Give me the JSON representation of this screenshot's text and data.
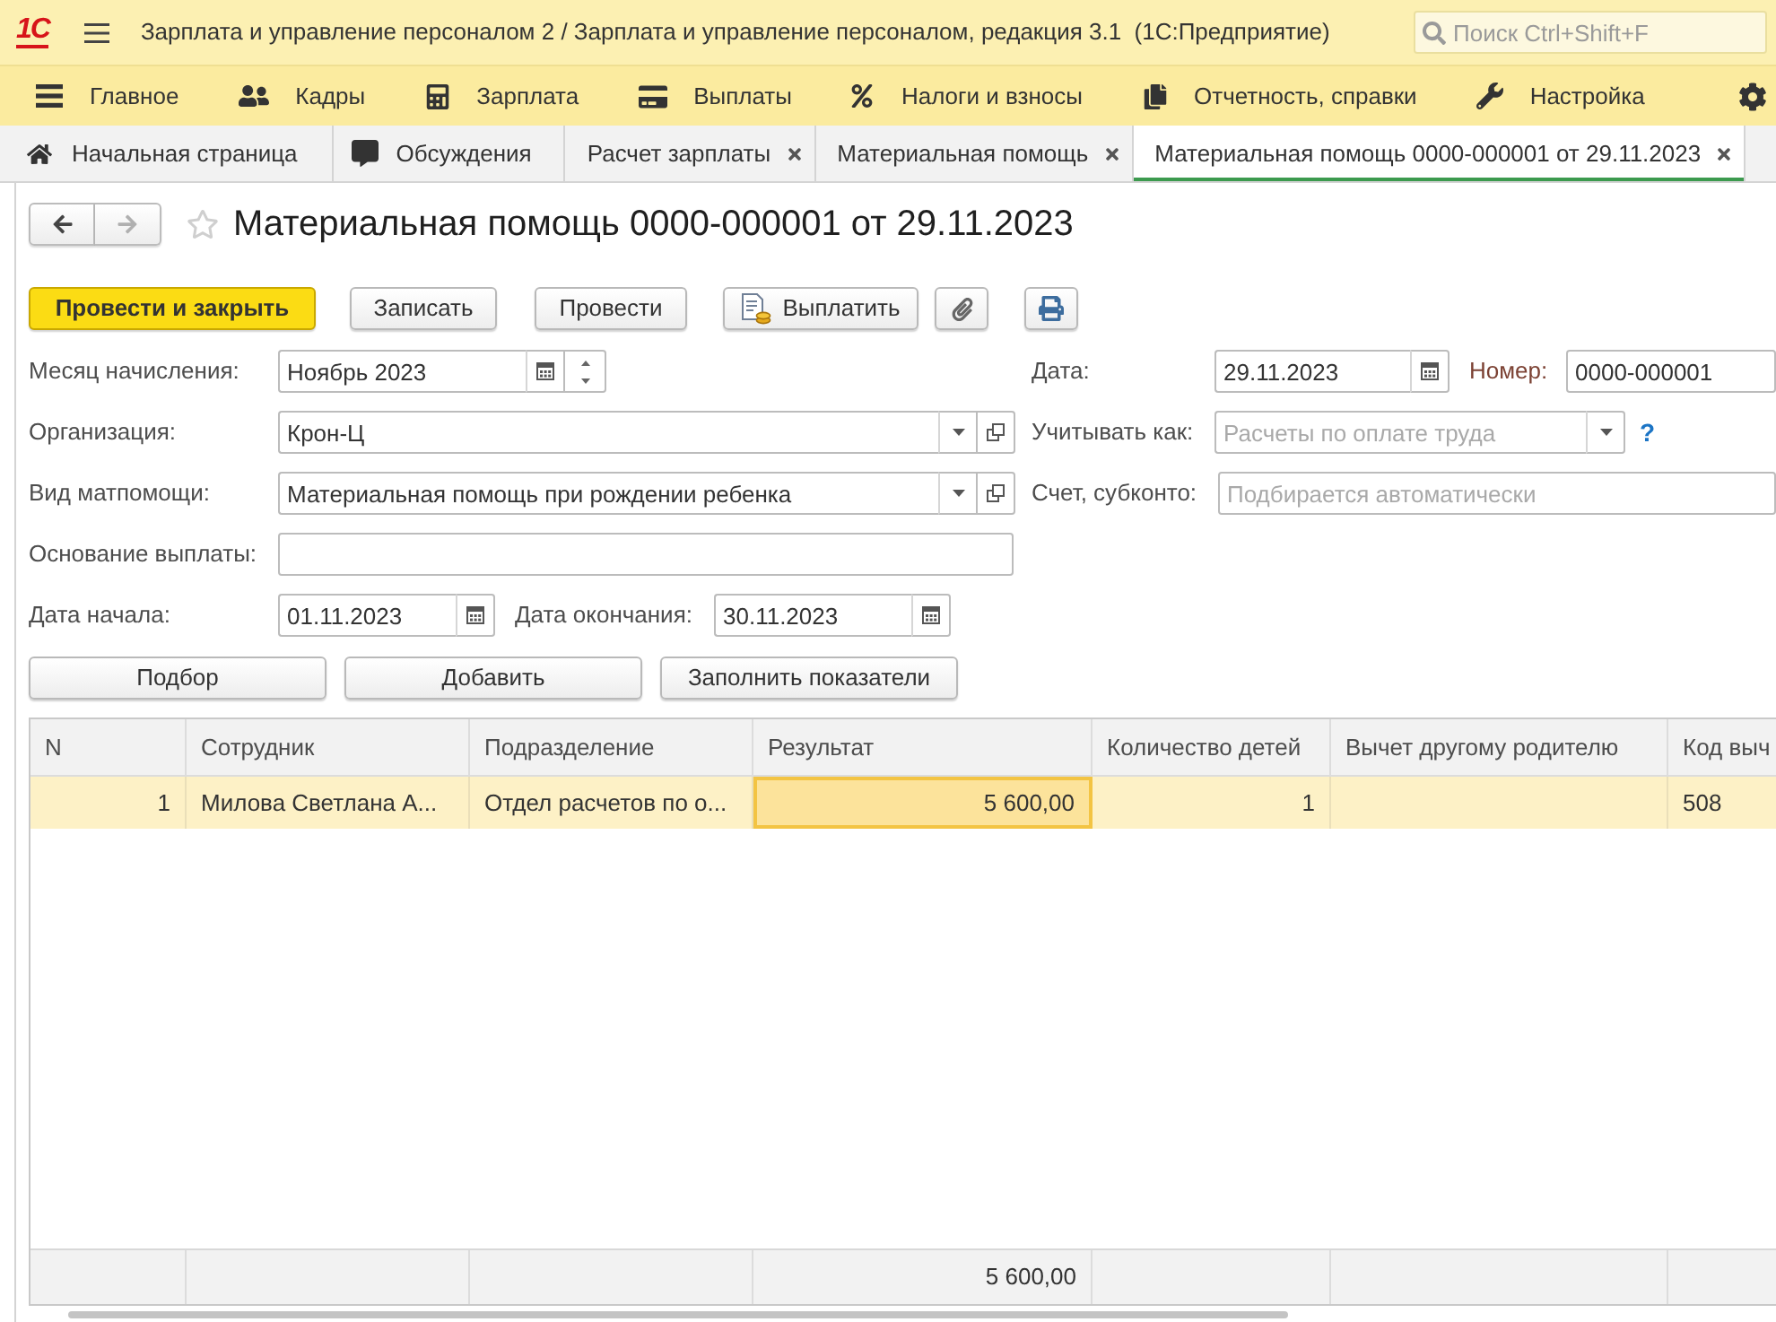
{
  "title_bar": {
    "logo": "1С",
    "title": "Зарплата и управление персоналом 2 / Зарплата и управление персоналом, редакция 3.1  (1С:Предприятие)",
    "search": {
      "placeholder": "Поиск Ctrl+Shift+F"
    }
  },
  "sections": [
    {
      "label": "Главное"
    },
    {
      "label": "Кадры"
    },
    {
      "label": "Зарплата"
    },
    {
      "label": "Выплаты"
    },
    {
      "label": "Налоги и взносы"
    },
    {
      "label": "Отчетность, справки"
    },
    {
      "label": "Настройка"
    }
  ],
  "tabs": [
    {
      "kind": "home",
      "label": "Начальная страница",
      "selected": false
    },
    {
      "kind": "discussions",
      "label": "Обсуждения",
      "selected": false
    },
    {
      "kind": "document",
      "label": "Расчет зарплаты",
      "selected": false
    },
    {
      "kind": "document",
      "label": "Материальная помощь",
      "selected": false
    },
    {
      "kind": "document",
      "label": "Материальная помощь 0000-000001 от 29.11.2023",
      "selected": true
    }
  ],
  "form": {
    "title": "Материальная помощь 0000-000001 от 29.11.2023",
    "favorite": false,
    "back_disabled": false,
    "forward_disabled": true
  },
  "commands": [
    {
      "kind": "primary",
      "label": "Провести и закрыть"
    },
    {
      "kind": "plain",
      "label": "Записать"
    },
    {
      "kind": "plain",
      "label": "Провести"
    },
    {
      "kind": "pay",
      "label": "Выплатить"
    },
    {
      "kind": "attach"
    },
    {
      "kind": "print"
    }
  ],
  "fields": {
    "accrual_month": {
      "label": "Месяц начисления:",
      "value": "Ноябрь 2023"
    },
    "date": {
      "label": "Дата:",
      "value": "29.11.2023"
    },
    "number": {
      "label": "Номер:",
      "value": "0000-000001"
    },
    "organization": {
      "label": "Организация:",
      "value": "Крон-Ц"
    },
    "account_as": {
      "label": "Учитывать как:",
      "placeholder": "Расчеты по оплате труда",
      "help": "?"
    },
    "aid_type": {
      "label": "Вид матпомощи:",
      "value": "Материальная помощь при рождении ребенка"
    },
    "account_subconto": {
      "label": "Счет, субконто:",
      "placeholder": "Подбирается автоматически"
    },
    "payment_basis": {
      "label": "Основание выплаты:"
    },
    "start_date": {
      "label": "Дата начала:",
      "value": "01.11.2023"
    },
    "end_date": {
      "label": "Дата окончания:",
      "value": "30.11.2023"
    }
  },
  "table_commands": [
    {
      "label": "Подбор"
    },
    {
      "label": "Добавить"
    },
    {
      "label": "Заполнить показатели"
    }
  ],
  "table": {
    "columns": [
      {
        "title": "N"
      },
      {
        "title": "Сотрудник"
      },
      {
        "title": "Подразделение"
      },
      {
        "title": "Результат",
        "total": "5 600,00"
      },
      {
        "title": "Количество детей"
      },
      {
        "title": "Вычет другому родителю"
      },
      {
        "title": "Код выч"
      }
    ],
    "rows": [
      {
        "selected": true,
        "cells": [
          {
            "text": "1",
            "current": false
          },
          {
            "text": "Милова Светлана А...",
            "current": false
          },
          {
            "text": "Отдел расчетов по о...",
            "current": false
          },
          {
            "text": "5 600,00",
            "current": true
          },
          {
            "text": "1",
            "current": false
          },
          {
            "current": false
          },
          {
            "text": "508",
            "current": false
          }
        ]
      }
    ]
  }
}
